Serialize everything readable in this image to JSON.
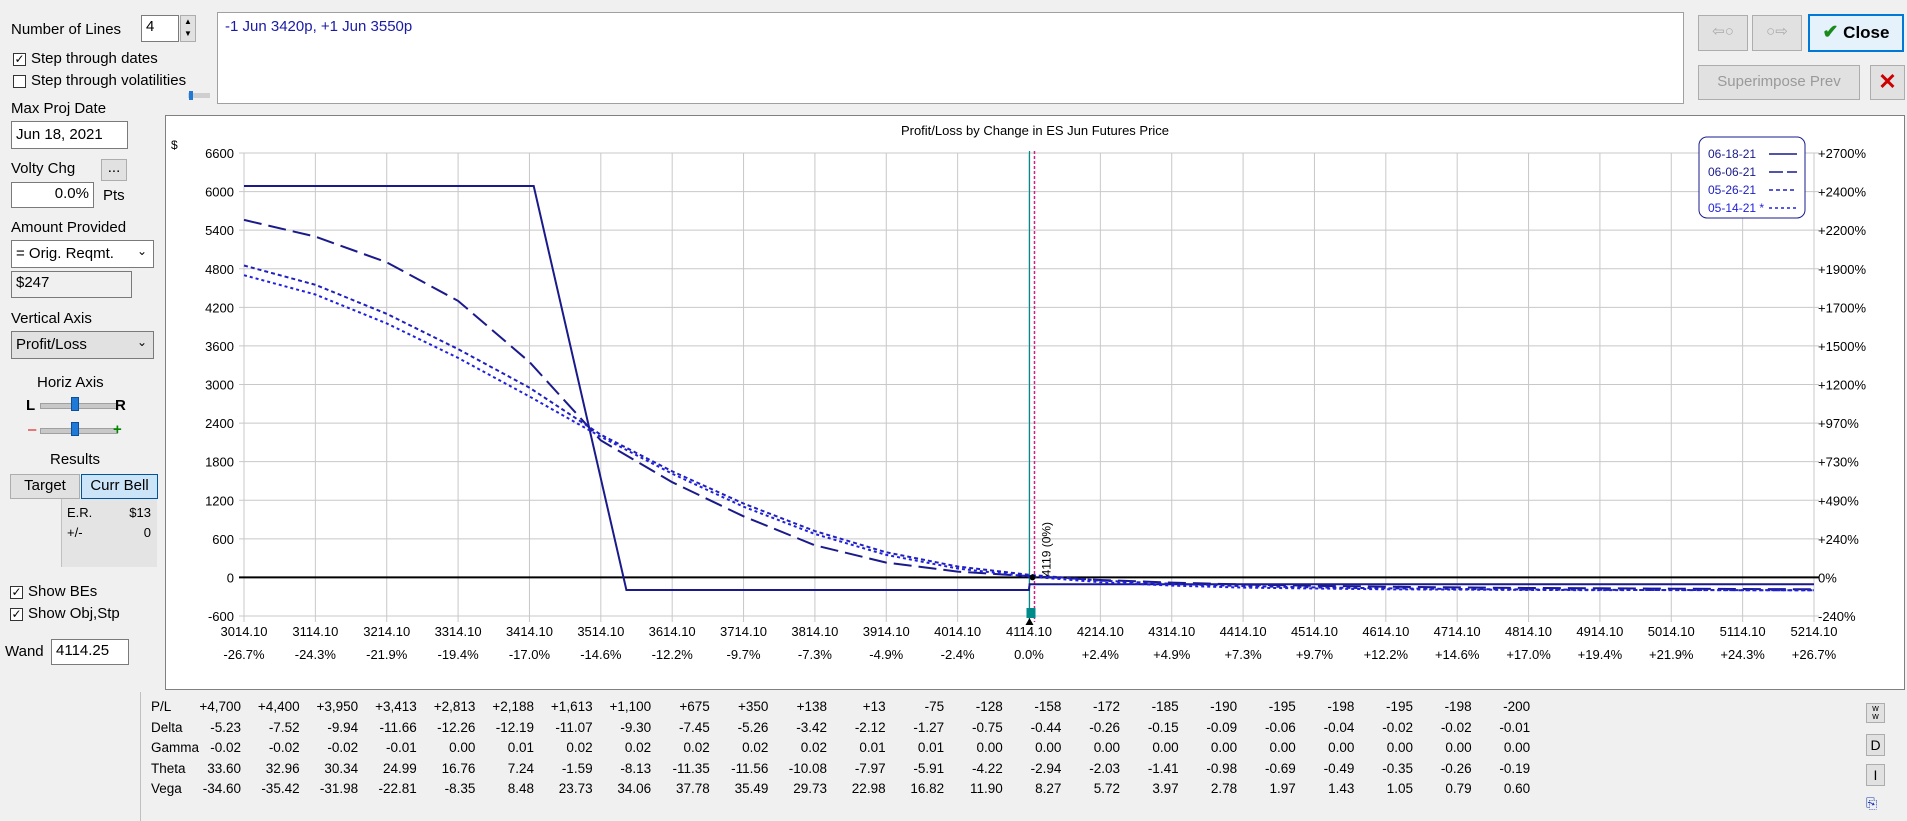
{
  "controls": {
    "num_lines_label": "Number of Lines",
    "num_lines_value": "4",
    "step_dates_label": "Step through dates",
    "step_dates_checked": true,
    "step_vols_label": "Step through volatilities",
    "step_vols_checked": false,
    "max_proj_label": "Max Proj Date",
    "max_proj_value": "Jun 18, 2021",
    "volty_label": "Volty Chg",
    "volty_btn": "...",
    "volty_value": "0.0%",
    "volty_unit": "Pts",
    "amount_label": "Amount Provided",
    "amount_select": "= Orig. Reqmt.",
    "amount_value": "$247",
    "vaxis_label": "Vertical Axis",
    "vaxis_select": "Profit/Loss",
    "haxis_label": "Horiz Axis",
    "haxis_l": "L",
    "haxis_r": "R",
    "minus": "–",
    "plus": "+",
    "results_label": "Results",
    "target_btn": "Target",
    "curr_bell_btn": "Curr Bell",
    "er_label": "E.R.",
    "er_value": "$13",
    "pm_label": "+/-",
    "pm_value": "0",
    "show_bes_label": "Show BEs",
    "show_bes_checked": true,
    "show_obj_label": "Show Obj,Stp",
    "show_obj_checked": true,
    "wand_label": "Wand",
    "wand_value": "4114.25"
  },
  "position_text": "-1 Jun 3420p, +1 Jun 3550p",
  "buttons": {
    "close": "Close",
    "superimpose": "Superimpose Prev"
  },
  "icons": {
    "back": "arrow-left-icon",
    "fwd": "arrow-right-icon",
    "close_check": "checkmark-icon",
    "red_x": "red-x-icon"
  },
  "chart_data": {
    "type": "line",
    "title": "Profit/Loss by Change in ES Jun Futures Price",
    "ylabel_unit": "$",
    "yticks": [
      "6600",
      "6000",
      "5400",
      "4800",
      "4200",
      "3600",
      "3000",
      "2400",
      "1800",
      "1200",
      "600",
      "0",
      "-600"
    ],
    "ytick_values": [
      6600,
      6000,
      5400,
      4800,
      4200,
      3600,
      3000,
      2400,
      1800,
      1200,
      600,
      0,
      -600
    ],
    "right_ticks": [
      "+2700%",
      "+2400%",
      "+2200%",
      "+1900%",
      "+1700%",
      "+1500%",
      "+1200%",
      "+970%",
      "+730%",
      "+490%",
      "+240%",
      "0%",
      "-240%"
    ],
    "ylim": [
      -600,
      6600
    ],
    "x": [
      3014.1,
      3114.1,
      3214.1,
      3314.1,
      3414.1,
      3514.1,
      3614.1,
      3714.1,
      3814.1,
      3914.1,
      4014.1,
      4114.1,
      4214.1,
      4314.1,
      4414.1,
      4514.1,
      4614.1,
      4714.1,
      4814.1,
      4914.1,
      5014.1,
      5114.1,
      5214.1
    ],
    "xtick_labels": [
      "3014.10",
      "3114.10",
      "3214.10",
      "3314.10",
      "3414.10",
      "3514.10",
      "3614.10",
      "3714.10",
      "3814.10",
      "3914.10",
      "4014.10",
      "4114.10",
      "4214.10",
      "4314.10",
      "4414.10",
      "4514.10",
      "4614.10",
      "4714.10",
      "4814.10",
      "4914.10",
      "5014.10",
      "5114.10",
      "5214.10"
    ],
    "xpct_labels": [
      "-26.7%",
      "-24.3%",
      "-21.9%",
      "-19.4%",
      "-17.0%",
      "-14.6%",
      "-12.2%",
      "-9.7%",
      "-7.3%",
      "-4.9%",
      "-2.4%",
      "0.0%",
      "+2.4%",
      "+4.9%",
      "+7.3%",
      "+9.7%",
      "+12.2%",
      "+14.6%",
      "+17.0%",
      "+19.4%",
      "+21.9%",
      "+24.3%",
      "+26.7%"
    ],
    "xlim": [
      3014.1,
      5214.1
    ],
    "current_price_label": "4119 (0%)",
    "current_price": 4119,
    "legend_placement": "top-right",
    "series": [
      {
        "name": "06-18-21",
        "color": "#1a1a8c",
        "dash": "",
        "x": [
          3014.1,
          3420,
          3550,
          4114,
          4115,
          5214.1
        ],
        "values": [
          6087,
          6087,
          -195,
          -195,
          -105,
          -105
        ]
      },
      {
        "name": "06-06-21",
        "color": "#1a1a8c",
        "dash": "18,7",
        "x": [
          3014.1,
          3114.1,
          3214.1,
          3314.1,
          3414.1,
          3514.1,
          3614.1,
          3714.1,
          3814.1,
          3914.1,
          4014.1,
          4114.1,
          4214.1,
          4314.1,
          4414.1,
          4514.1,
          4614.1,
          4714.1,
          4814.1,
          4914.1,
          5014.1,
          5114.1,
          5214.1
        ],
        "values": [
          5560,
          5300,
          4900,
          4300,
          3350,
          2130,
          1480,
          950,
          500,
          230,
          90,
          20,
          -40,
          -80,
          -110,
          -130,
          -145,
          -155,
          -165,
          -170,
          -175,
          -180,
          -185
        ]
      },
      {
        "name": "05-26-21",
        "color": "#2020c0",
        "dash": "4,3",
        "x": [
          3014.1,
          3114.1,
          3214.1,
          3314.1,
          3414.1,
          3514.1,
          3614.1,
          3714.1,
          3814.1,
          3914.1,
          4014.1,
          4114.1,
          4214.1,
          4314.1,
          4414.1,
          4514.1,
          4614.1,
          4714.1,
          4814.1,
          4914.1,
          5014.1,
          5114.1,
          5214.1
        ],
        "values": [
          4850,
          4550,
          4100,
          3550,
          2950,
          2220,
          1650,
          1150,
          720,
          390,
          170,
          40,
          -50,
          -100,
          -135,
          -155,
          -170,
          -180,
          -188,
          -193,
          -197,
          -199,
          -200
        ]
      },
      {
        "name": "05-14-21 *",
        "color": "#2020e0",
        "dash": "3,3",
        "x": [
          3014.1,
          3114.1,
          3214.1,
          3314.1,
          3414.1,
          3514.1,
          3614.1,
          3714.1,
          3814.1,
          3914.1,
          4014.1,
          4114.1,
          4214.1,
          4314.1,
          4414.1,
          4514.1,
          4614.1,
          4714.1,
          4814.1,
          4914.1,
          5014.1,
          5114.1,
          5214.1
        ],
        "values": [
          4700,
          4400,
          3950,
          3413,
          2813,
          2188,
          1613,
          1100,
          675,
          350,
          138,
          13,
          -75,
          -128,
          -158,
          -172,
          -185,
          -190,
          -195,
          -198,
          -195,
          -198,
          -200
        ]
      }
    ]
  },
  "table": {
    "rows": [
      {
        "label": "P/L",
        "values": [
          "+4,700",
          "+4,400",
          "+3,950",
          "+3,413",
          "+2,813",
          "+2,188",
          "+1,613",
          "+1,100",
          "+675",
          "+350",
          "+138",
          "+13",
          "-75",
          "-128",
          "-158",
          "-172",
          "-185",
          "-190",
          "-195",
          "-198",
          "-195",
          "-198",
          "-200"
        ]
      },
      {
        "label": "Delta",
        "values": [
          "-5.23",
          "-7.52",
          "-9.94",
          "-11.66",
          "-12.26",
          "-12.19",
          "-11.07",
          "-9.30",
          "-7.45",
          "-5.26",
          "-3.42",
          "-2.12",
          "-1.27",
          "-0.75",
          "-0.44",
          "-0.26",
          "-0.15",
          "-0.09",
          "-0.06",
          "-0.04",
          "-0.02",
          "-0.02",
          "-0.01"
        ]
      },
      {
        "label": "Gamma",
        "values": [
          "-0.02",
          "-0.02",
          "-0.02",
          "-0.01",
          "0.00",
          "0.01",
          "0.02",
          "0.02",
          "0.02",
          "0.02",
          "0.02",
          "0.01",
          "0.01",
          "0.00",
          "0.00",
          "0.00",
          "0.00",
          "0.00",
          "0.00",
          "0.00",
          "0.00",
          "0.00",
          "0.00"
        ]
      },
      {
        "label": "Theta",
        "values": [
          "33.60",
          "32.96",
          "30.34",
          "24.99",
          "16.76",
          "7.24",
          "-1.59",
          "-8.13",
          "-11.35",
          "-11.56",
          "-10.08",
          "-7.97",
          "-5.91",
          "-4.22",
          "-2.94",
          "-2.03",
          "-1.41",
          "-0.98",
          "-0.69",
          "-0.49",
          "-0.35",
          "-0.26",
          "-0.19"
        ]
      },
      {
        "label": "Vega",
        "values": [
          "-34.60",
          "-35.42",
          "-31.98",
          "-22.81",
          "-8.35",
          "8.48",
          "23.73",
          "34.06",
          "37.78",
          "35.49",
          "29.73",
          "22.98",
          "16.82",
          "11.90",
          "8.27",
          "5.72",
          "3.97",
          "2.78",
          "1.97",
          "1.43",
          "1.05",
          "0.79",
          "0.60"
        ]
      }
    ],
    "side_buttons": [
      "D",
      "I"
    ]
  }
}
